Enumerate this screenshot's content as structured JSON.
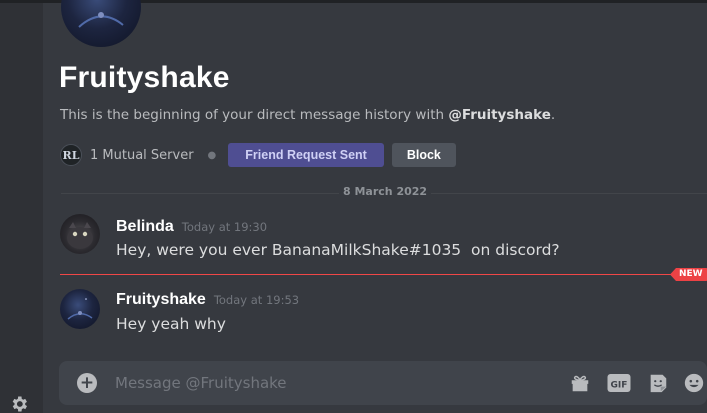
{
  "dm": {
    "title": "Fruityshake",
    "desc_prefix": "This is the beginning of your direct message history with ",
    "desc_handle": "@Fruityshake",
    "desc_suffix": ".",
    "mutual_server_icon_text": "RL",
    "mutual_servers": "1 Mutual Server",
    "friend_request_button": "Friend Request Sent",
    "block_button": "Block"
  },
  "date_divider": "8 March 2022",
  "messages": [
    {
      "author": "Belinda",
      "time": "Today at 19:30",
      "text": "Hey, were you ever BananaMilkShake#1035  on discord?"
    },
    {
      "author": "Fruityshake",
      "time": "Today at 19:53",
      "text": "Hey yeah why"
    }
  ],
  "new_badge": "NEW",
  "composer": {
    "placeholder": "Message @Fruityshake",
    "gif_label": "GIF"
  },
  "icons": {
    "settings": "gear-icon",
    "add": "plus-circle-icon",
    "gift": "gift-icon",
    "gif": "gif-icon",
    "sticker": "sticker-icon",
    "emoji": "emoji-icon"
  },
  "colors": {
    "background": "#36393f",
    "friend_request": "#4f4e92",
    "block": "#4f545c",
    "new_marker": "#ed4245"
  }
}
